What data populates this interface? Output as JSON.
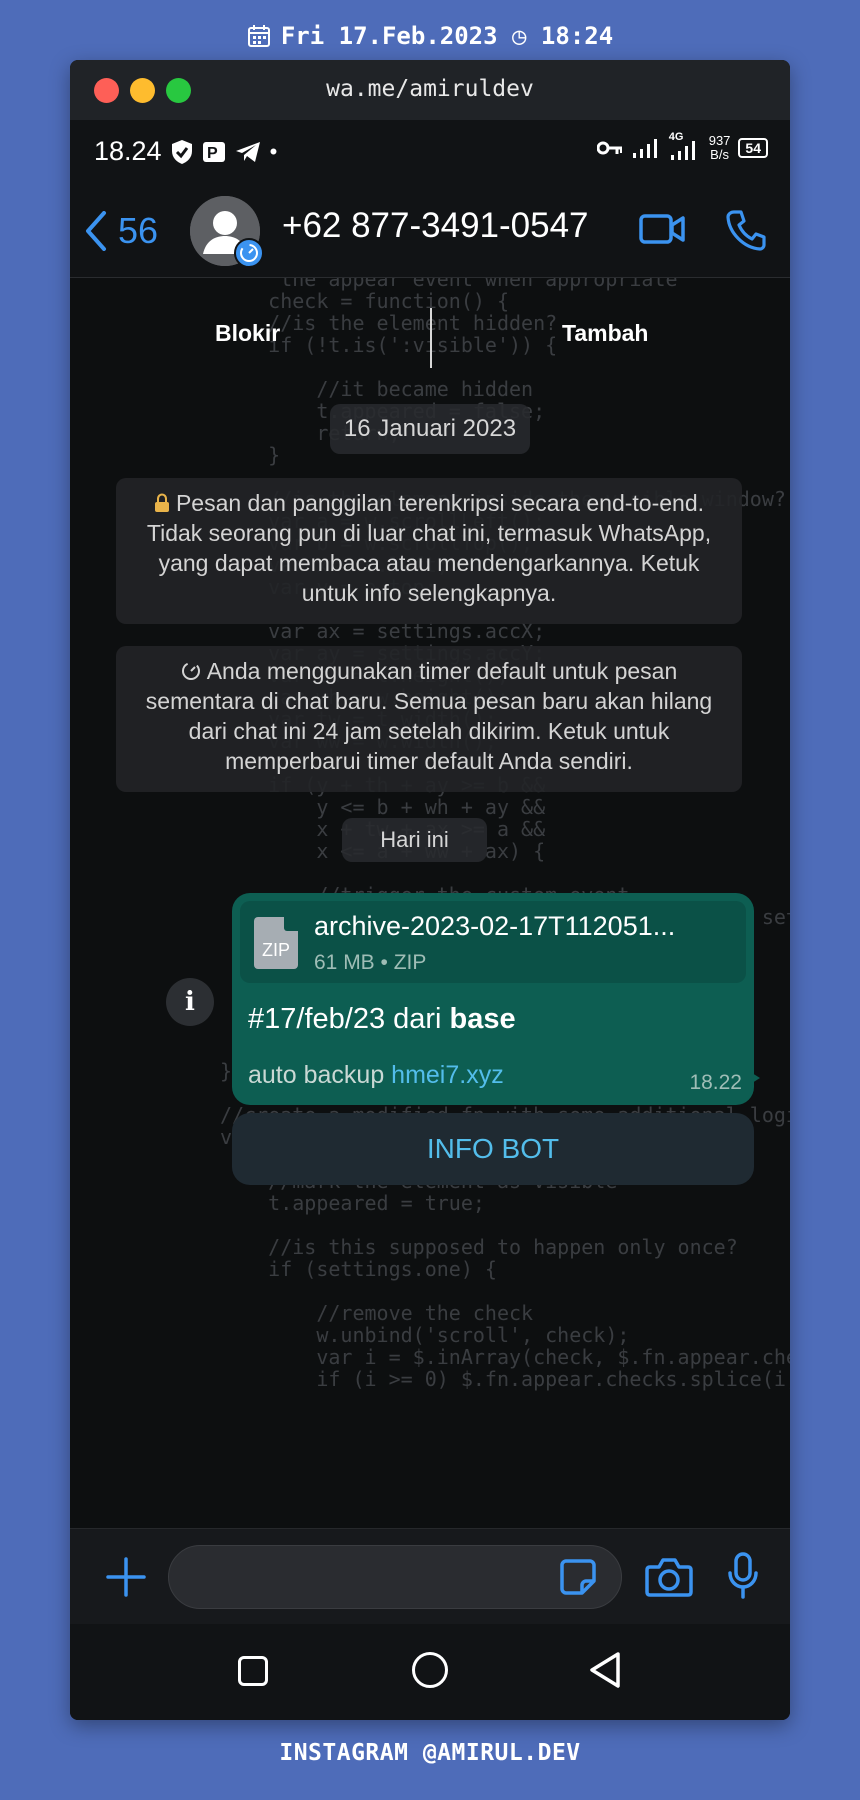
{
  "caption": {
    "top_text": "Fri 17.Feb.2023 ◷ 18:24",
    "bottom_text": "INSTAGRAM @AMIRUL.DEV"
  },
  "window": {
    "url": "wa.me/amiruldev"
  },
  "statusbar": {
    "time": "18.24",
    "netspeed_value": "937",
    "netspeed_unit": "B/s",
    "battery": "54",
    "network_type": "4G"
  },
  "header": {
    "back_count": "56",
    "contact_name": "+62 877-3491-0547"
  },
  "actions": {
    "block_label": "Blokir",
    "add_label": "Tambah"
  },
  "chat": {
    "date_label": "16 Januari 2023",
    "encryption_notice": "Pesan dan panggilan terenkripsi secara end-to-end. Tidak seorang pun di luar chat ini, termasuk WhatsApp, yang dapat membaca atau mendengarkannya. Ketuk untuk info selengkapnya.",
    "timer_notice": "Anda menggunakan timer default untuk pesan sementara di chat baru. Semua pesan baru akan hilang dari chat ini 24 jam setelah dikirim. Ketuk untuk memperbarui timer default Anda sendiri.",
    "today_label": "Hari ini",
    "message": {
      "attachment_name": "archive-2023-02-17T112051...",
      "attachment_meta": "61 MB • ZIP",
      "attachment_icon_label": "ZIP",
      "title_prefix": "#17/feb/23 dari ",
      "title_bold": "base",
      "body_prefix": "auto backup ",
      "body_link": "hmei7.xyz",
      "time": "18.22"
    },
    "info_bot_label": "INFO BOT"
  },
  "code_background": "     the appear event when appropriate\n    check = function() {\n    //is the element hidden?\n    if (!t.is(':visible')) {\n\n        //it became hidden\n        t.appeared = false;\n        return;\n    }\n\n    //is the element inside the visible window?\n    var a = w.scrollLeft();\n    var b = w.scrollTop();\n    var x = o.left;\n    var y = o.top;\n\n    var ax = settings.accX;\n    var ay = settings.accY;\n    var th = t.height();\n    var wh = w.height();\n    var tw = t.width();\n    var ww = w.width();\n\n    if (y + th + ay >= b &&\n        y <= b + wh + ay &&\n        x + tw + ax >= a &&\n        x <= a + ww + ax) {\n\n        //trigger the custom event\n        if (!t.appeared) t.trigger('appear', settings.data);\n\n    } else {\n\n        //it scrolled out of view\n        t.appeared = false;\n    }\n};\n\n//create a modified fn with some additional logic\nvar modifiedFn = function() {\n\n    //mark the element as visible\n    t.appeared = true;\n\n    //is this supposed to happen only once?\n    if (settings.one) {\n\n        //remove the check\n        w.unbind('scroll', check);\n        var i = $.inArray(check, $.fn.appear.checks);\n        if (i >= 0) $.fn.appear.checks.splice(i, 1);",
  "colors": {
    "background": "#4e6cb9",
    "accent": "#3b93f0",
    "outgoing_bubble": "#0d5e52",
    "link": "#53bdeb"
  },
  "icons": {
    "calendar": "calendar-icon",
    "clock": "clock-icon",
    "shield": "shield-icon",
    "telegram": "telegram-icon",
    "key": "key-icon",
    "signal": "signal-icon",
    "video": "video-call-icon",
    "phone": "phone-call-icon",
    "lock": "lock-icon",
    "timer": "timer-icon",
    "plus": "plus-icon",
    "sticker": "sticker-icon",
    "camera": "camera-icon",
    "mic": "mic-icon"
  }
}
